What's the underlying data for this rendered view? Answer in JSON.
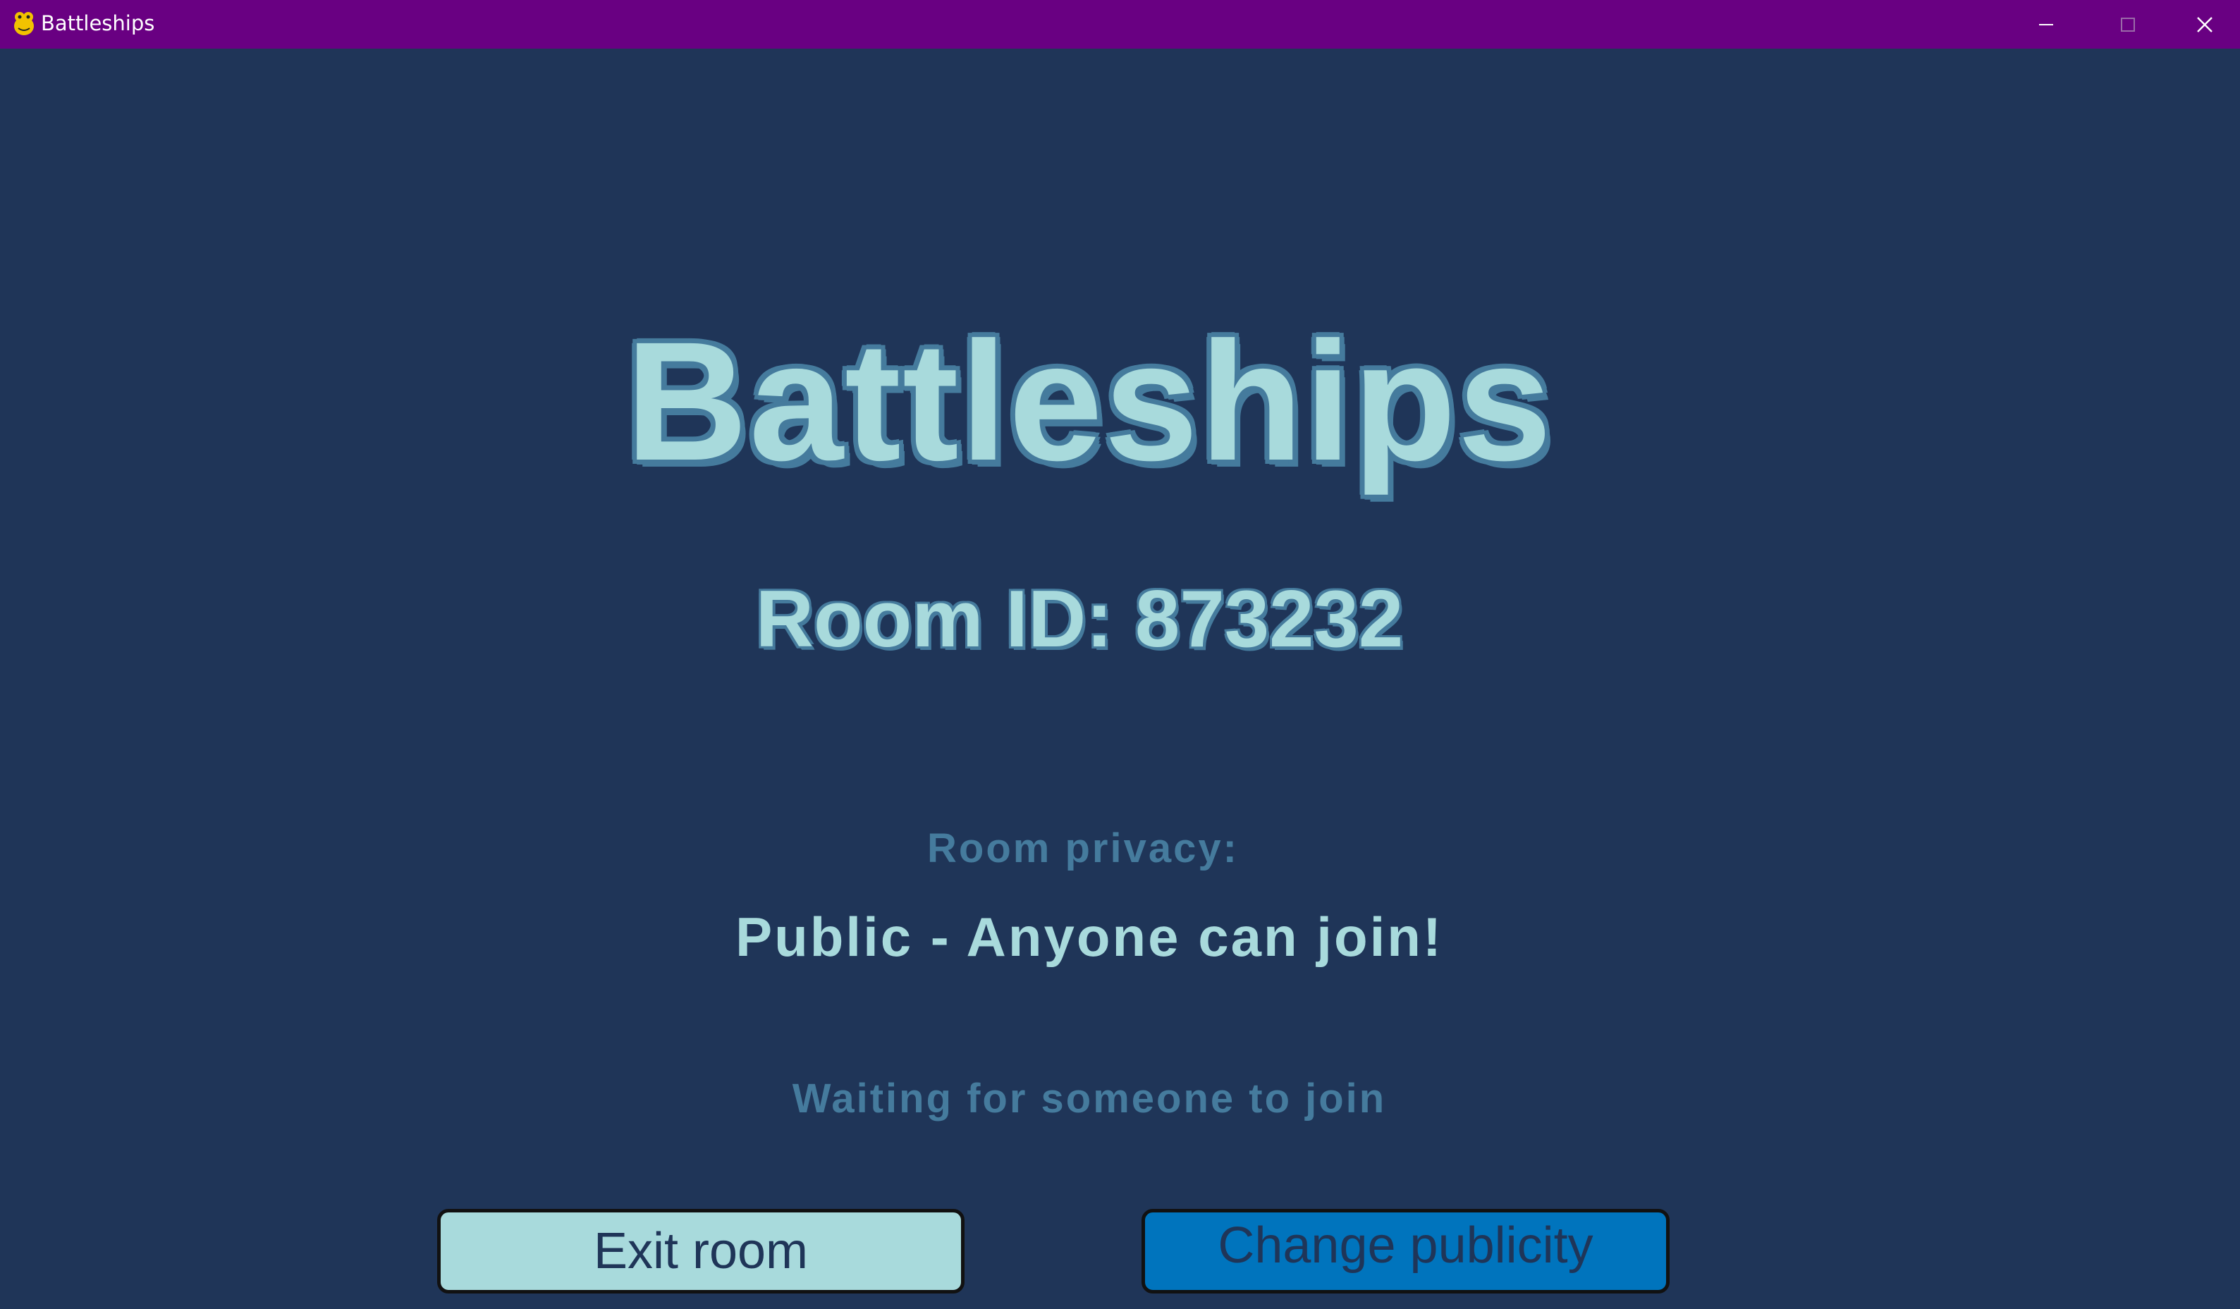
{
  "window": {
    "title": "Battleships",
    "icon": "python-snake-icon",
    "controls": [
      "minimize-icon",
      "maximize-icon",
      "close-icon"
    ]
  },
  "game": {
    "title": "Battleships",
    "room_id_text": "Room ID: 873232",
    "privacy_label": "Room privacy:",
    "privacy_value": "Public - Anyone can join!",
    "status_text": "Waiting for someone to join"
  },
  "buttons": {
    "exit_label": "Exit room",
    "change_label": "Change publicity"
  },
  "colors": {
    "titlebar": "#690082",
    "background": "#1f3558",
    "text_light": "#a8dadc",
    "text_muted": "#457b9d",
    "exit_button": "#a8dadc",
    "change_button": "#0074bd"
  }
}
